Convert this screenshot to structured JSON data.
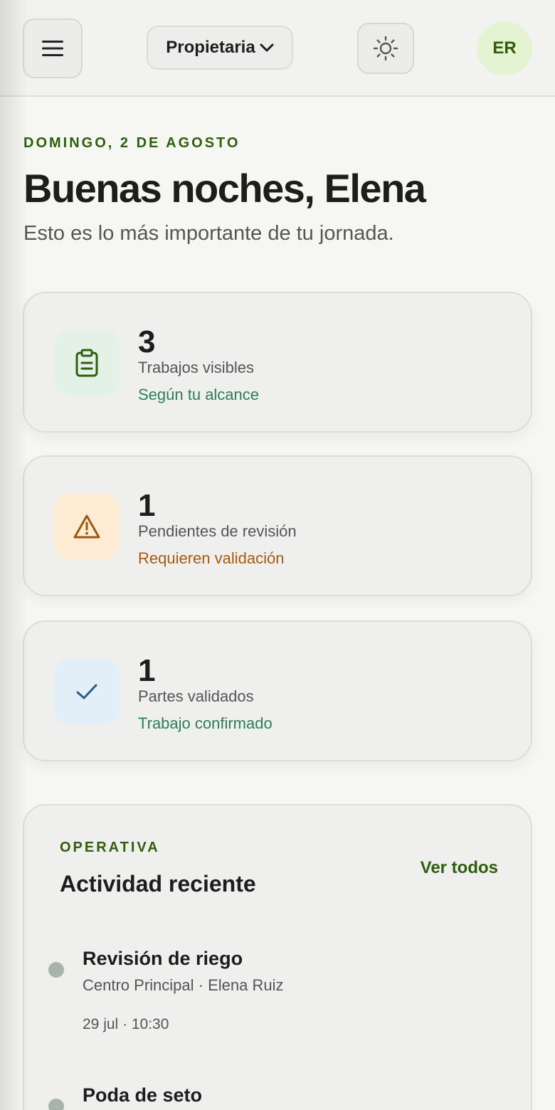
{
  "header": {
    "menu_icon": "hamburger-menu-icon",
    "role_selected": "Propietaria",
    "role_chevron_icon": "chevron-down-icon",
    "theme_icon": "sun-icon",
    "avatar_initials": "ER"
  },
  "greeting": {
    "date": "DOMINGO, 2 DE AGOSTO",
    "title": "Buenas noches, Elena",
    "subtitle": "Esto es lo más importante de tu jornada."
  },
  "stats": [
    {
      "icon": "clipboard-icon",
      "value": "3",
      "label": "Trabajos visibles",
      "note": "Según tu alcance",
      "icon_bg": "#e3f1e7",
      "icon_color": "#2f5e0f",
      "note_color": "#2e7d5b"
    },
    {
      "icon": "warning-triangle-icon",
      "value": "1",
      "label": "Pendientes de revisión",
      "note": "Requieren validación",
      "icon_bg": "#fdebd4",
      "icon_color": "#9a5a12",
      "note_color": "#a75a12"
    },
    {
      "icon": "checkmark-icon",
      "value": "1",
      "label": "Partes validados",
      "note": "Trabajo confirmado",
      "icon_bg": "#e2eef8",
      "icon_color": "#2b5d8e",
      "note_color": "#2e7d5b"
    }
  ],
  "activity": {
    "kicker": "OPERATIVA",
    "title": "Actividad reciente",
    "see_all": "Ver todos",
    "items": [
      {
        "title": "Revisión de riego",
        "meta": "Centro Principal · Elena Ruiz",
        "time": "29 jul · 10:30"
      },
      {
        "title": "Poda de seto",
        "meta": "",
        "time": ""
      }
    ]
  }
}
